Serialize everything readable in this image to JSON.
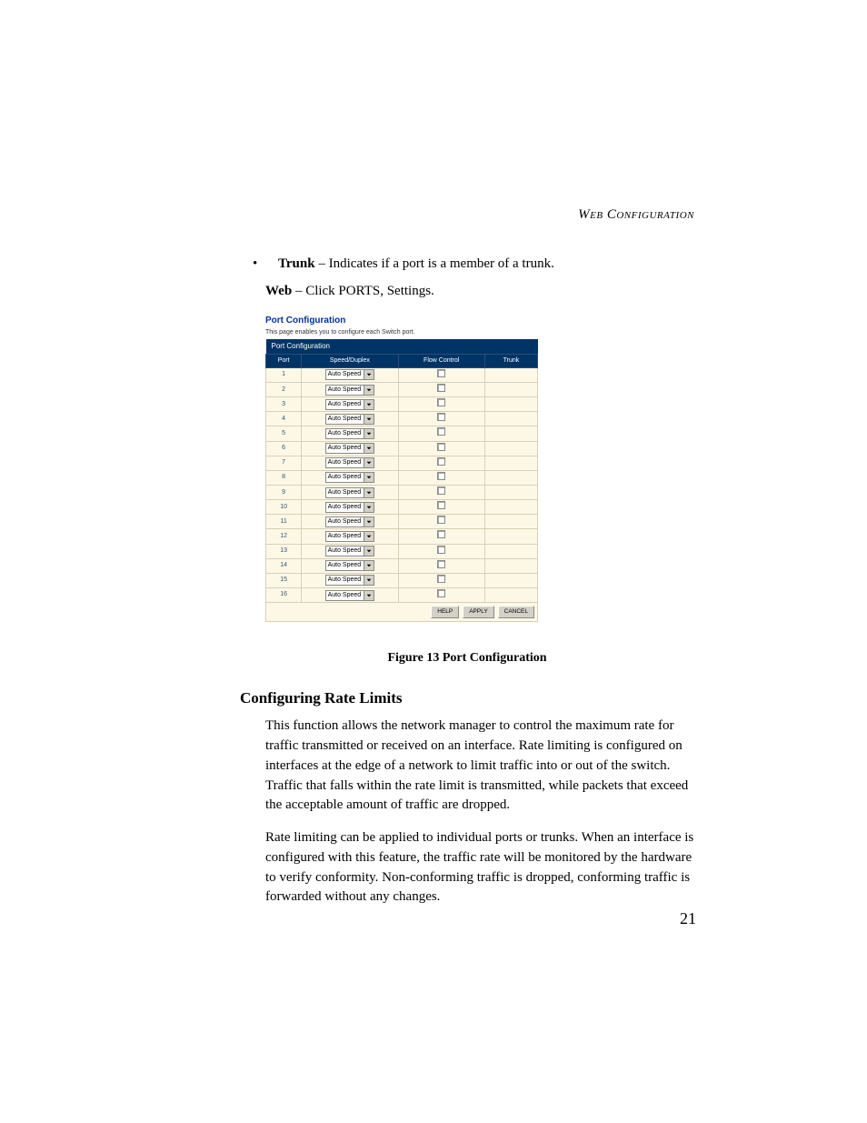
{
  "header": {
    "running": "Web Configuration"
  },
  "intro": {
    "bullet_strong": "Trunk",
    "bullet_rest": " – Indicates if a port is a member of a trunk.",
    "web_strong": "Web",
    "web_rest": " – Click PORTS, Settings."
  },
  "screenshot": {
    "title": "Port Configuration",
    "subtitle": "This page enables you to configure each Switch port.",
    "section_header": "Port Configuration",
    "cols": {
      "port": "Port",
      "speed": "Speed/Duplex",
      "flow": "Flow Control",
      "trunk": "Trunk"
    },
    "dropdown_label": "Auto Speed",
    "rows": [
      {
        "port": "1"
      },
      {
        "port": "2"
      },
      {
        "port": "3"
      },
      {
        "port": "4"
      },
      {
        "port": "5"
      },
      {
        "port": "6"
      },
      {
        "port": "7"
      },
      {
        "port": "8"
      },
      {
        "port": "9"
      },
      {
        "port": "10"
      },
      {
        "port": "11"
      },
      {
        "port": "12"
      },
      {
        "port": "13"
      },
      {
        "port": "14"
      },
      {
        "port": "15"
      },
      {
        "port": "16"
      }
    ],
    "buttons": {
      "help": "HELP",
      "apply": "APPLY",
      "cancel": "CANCEL"
    }
  },
  "figure_caption": "Figure 13  Port Configuration",
  "section_heading": "Configuring Rate Limits",
  "para1": "This function allows the network manager to control the maximum rate for traffic transmitted or received on an interface. Rate limiting is configured on interfaces at the edge of a network to limit traffic into or out of the switch. Traffic that falls within the rate limit is transmitted, while packets that exceed the acceptable amount of traffic are dropped.",
  "para2": "Rate limiting can be applied to individual ports or trunks. When an interface is configured with this feature, the traffic rate will be monitored by the hardware to verify conformity. Non-conforming traffic is dropped, conforming traffic is forwarded without any changes.",
  "page_number": "21"
}
